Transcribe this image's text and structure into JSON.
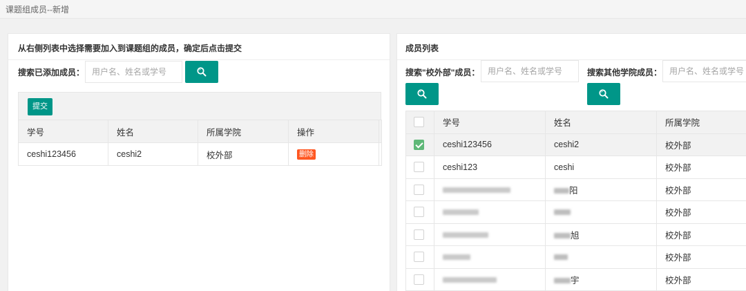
{
  "breadcrumb": "课题组成员--新增",
  "left_panel": {
    "title": "从右侧列表中选择需要加入到课题组的成员，确定后点击提交",
    "search_label": "搜索已添加成员：",
    "search_placeholder": "用户名、姓名或学号",
    "submit_label": "提交",
    "columns": [
      "学号",
      "姓名",
      "所属学院",
      "操作"
    ],
    "rows": [
      {
        "id": "ceshi123456",
        "name": "ceshi2",
        "college": "校外部",
        "action": "删除"
      }
    ]
  },
  "right_panel": {
    "title": "成员列表",
    "search1_label": "搜索\"校外部\"成员：",
    "search1_placeholder": "用户名、姓名或学号",
    "search2_label": "搜索其他学院成员：",
    "search2_placeholder": "用户名、姓名或学号",
    "columns": [
      "学号",
      "姓名",
      "所属学院"
    ],
    "rows": [
      {
        "checked": true,
        "id": "ceshi123456",
        "name": "ceshi2",
        "college": "校外部"
      },
      {
        "checked": false,
        "id": "ceshi123",
        "name": "ceshi",
        "college": "校外部"
      },
      {
        "checked": false,
        "id": "",
        "name": "阳",
        "college": "校外部"
      },
      {
        "checked": false,
        "id": "",
        "name": "",
        "college": "校外部"
      },
      {
        "checked": false,
        "id": "",
        "name": "旭",
        "college": "校外部"
      },
      {
        "checked": false,
        "id": "",
        "name": "",
        "college": "校外部"
      },
      {
        "checked": false,
        "id": "",
        "name": "宇",
        "college": "校外部"
      }
    ]
  },
  "icons": {
    "search": "search-icon",
    "check": "check-icon"
  },
  "colors": {
    "primary": "#009688",
    "danger": "#ff5722",
    "checked": "#5fb878"
  }
}
